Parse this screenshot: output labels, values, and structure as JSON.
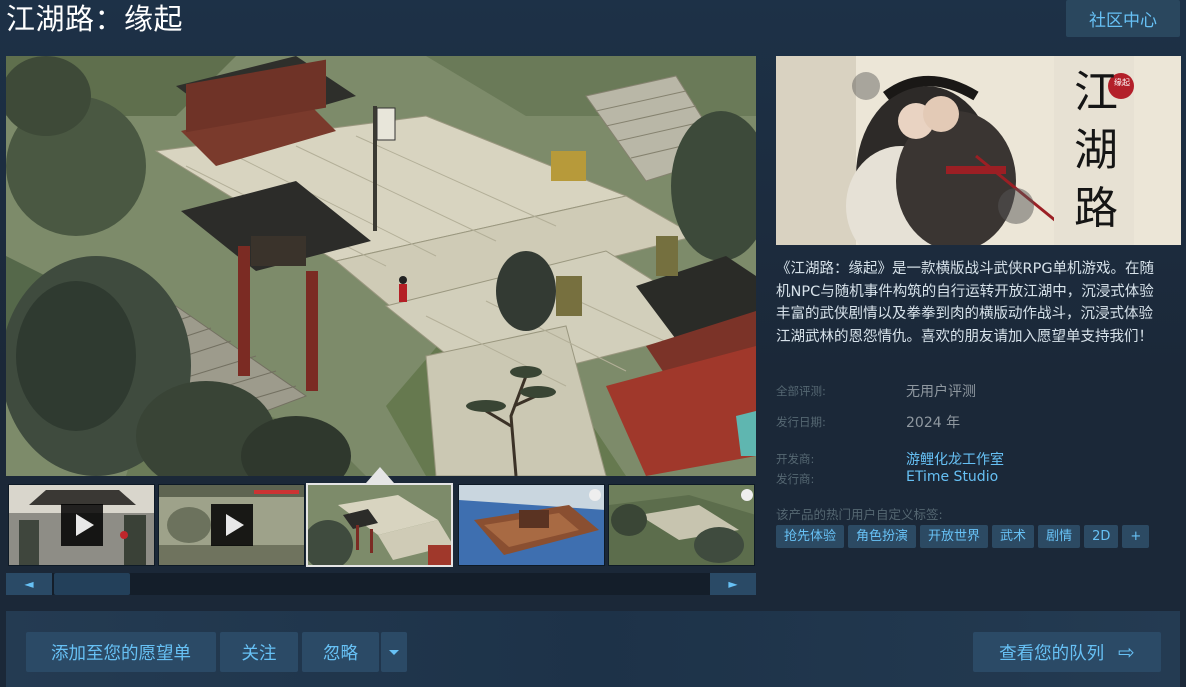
{
  "page": {
    "title": "江湖路：缘起",
    "community_hub_label": "社区中心"
  },
  "media": {
    "thumbnails": [
      {
        "type": "video"
      },
      {
        "type": "video"
      },
      {
        "type": "screenshot",
        "selected": true
      },
      {
        "type": "screenshot"
      },
      {
        "type": "screenshot"
      }
    ],
    "slider": {
      "left_icon": "◄",
      "right_icon": "►"
    }
  },
  "capsule": {
    "logo_text": [
      "江",
      "湖",
      "路"
    ],
    "seal_text": "缘起"
  },
  "description": "《江湖路：缘起》是一款横版战斗武侠RPG单机游戏。在随机NPC与随机事件构筑的自行运转开放江湖中，沉浸式体验丰富的武侠剧情以及拳拳到肉的横版动作战斗，沉浸式体验江湖武林的恩怨情仇。喜欢的朋友请加入愿望单支持我们！",
  "meta": {
    "reviews_label": "全部评测:",
    "reviews_value": "无用户评测",
    "release_label": "发行日期:",
    "release_value": "2024 年",
    "developer_label": "开发商:",
    "developer_value": "游鲤化龙工作室",
    "publisher_label": "发行商:",
    "publisher_value": "ETime Studio"
  },
  "tags": {
    "label": "该产品的热门用户自定义标签:",
    "items": [
      "抢先体验",
      "角色扮演",
      "开放世界",
      "武术",
      "剧情",
      "2D",
      "+"
    ]
  },
  "actions": {
    "wishlist_label": "添加至您的愿望单",
    "follow_label": "关注",
    "ignore_label": "忽略",
    "queue_label": "查看您的队列",
    "queue_icon": "⇨"
  },
  "colors": {
    "accent": "#67c1f5",
    "background": "#1b2838",
    "button": "#2b4a66"
  }
}
